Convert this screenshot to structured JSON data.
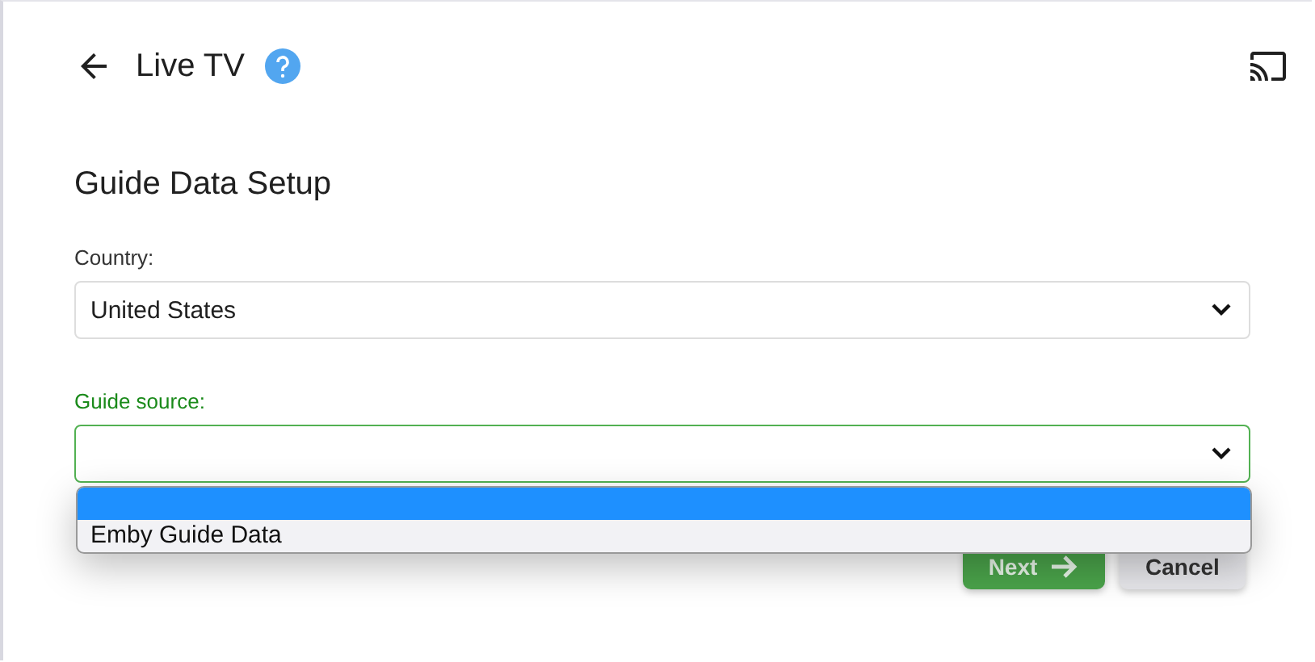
{
  "header": {
    "title": "Live TV"
  },
  "heading": "Guide Data Setup",
  "country": {
    "label": "Country:",
    "value": "United States"
  },
  "guide_source": {
    "label": "Guide source:",
    "focused": true,
    "expanded": true,
    "blank_option": {
      "selected": true
    },
    "options": [
      {
        "label": "Emby Guide Data",
        "selected": false
      }
    ]
  },
  "buttons": [
    {
      "label": "Next",
      "kind": "primary"
    },
    {
      "label": "Cancel",
      "kind": "secondary"
    }
  ]
}
